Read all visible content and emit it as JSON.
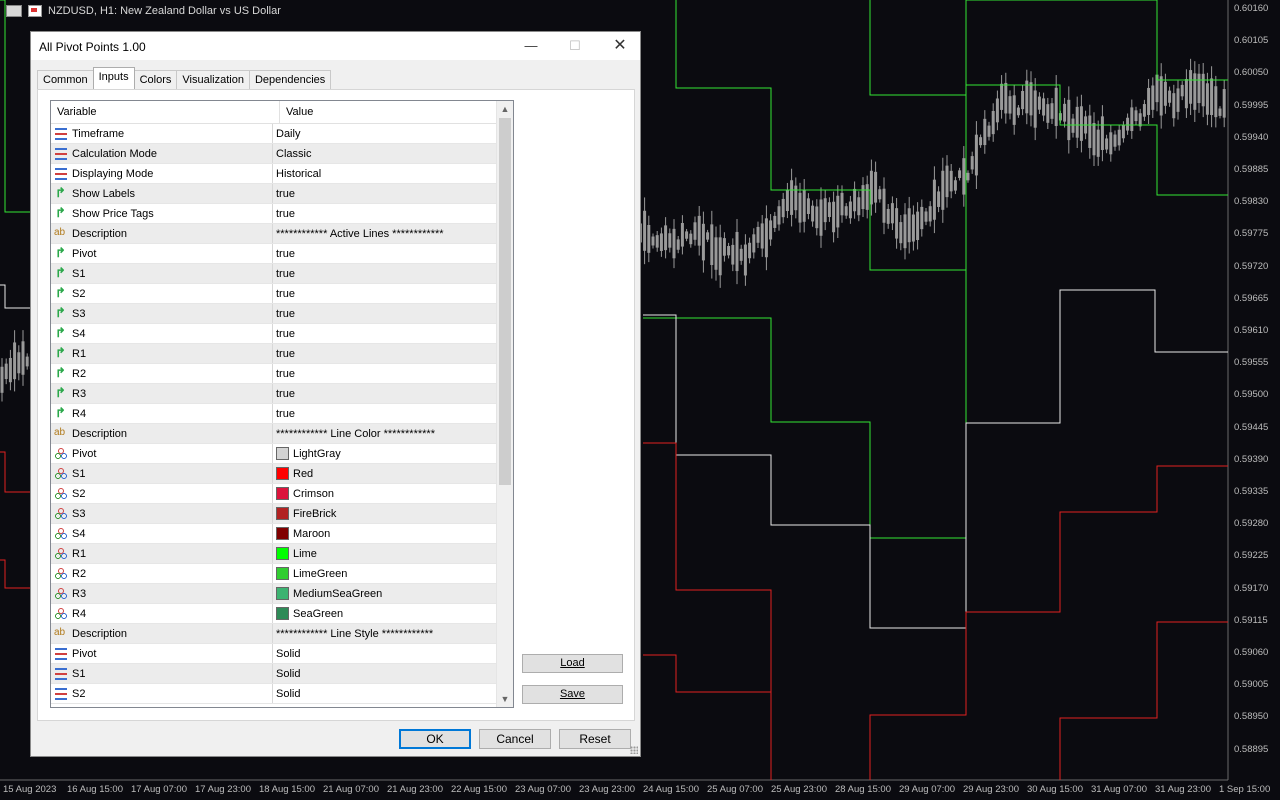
{
  "chart": {
    "symbol_title": "NZDUSD, H1:  New Zealand Dollar vs US Dollar",
    "price_labels": [
      "0.60160",
      "0.60105",
      "0.60050",
      "0.59995",
      "0.59940",
      "0.59885",
      "0.59830",
      "0.59775",
      "0.59720",
      "0.59665",
      "0.59610",
      "0.59555",
      "0.59500",
      "0.59445",
      "0.59390",
      "0.59335",
      "0.59280",
      "0.59225",
      "0.59170",
      "0.59115",
      "0.59060",
      "0.59005",
      "0.58950",
      "0.58895"
    ],
    "time_labels": [
      "15 Aug 2023",
      "16 Aug 15:00",
      "17 Aug 07:00",
      "17 Aug 23:00",
      "18 Aug 15:00",
      "21 Aug 07:00",
      "21 Aug 23:00",
      "22 Aug 15:00",
      "23 Aug 07:00",
      "23 Aug 23:00",
      "24 Aug 15:00",
      "25 Aug 07:00",
      "25 Aug 23:00",
      "28 Aug 15:00",
      "29 Aug 07:00",
      "29 Aug 23:00",
      "30 Aug 15:00",
      "31 Aug 07:00",
      "31 Aug 23:00",
      "1 Sep 15:00"
    ],
    "colors": {
      "background": "#0b0b10",
      "resistance": "#33e633",
      "support": "#e02020",
      "pivot": "#e8e8e8",
      "candle": "#9a9a9a"
    }
  },
  "dialog": {
    "title": "All Pivot Points 1.00",
    "minimize_icon": "minimize-icon",
    "maximize_icon": "maximize-icon",
    "close_icon": "close-icon",
    "tabs": [
      "Common",
      "Inputs",
      "Colors",
      "Visualization",
      "Dependencies"
    ],
    "active_tab": "Inputs",
    "grid": {
      "col_variable": "Variable",
      "col_value": "Value",
      "rows": [
        {
          "icon": "enum",
          "name": "Timeframe",
          "value": "Daily"
        },
        {
          "icon": "enum",
          "name": "Calculation Mode",
          "value": "Classic"
        },
        {
          "icon": "enum",
          "name": "Displaying Mode",
          "value": "Historical"
        },
        {
          "icon": "bool",
          "name": "Show Labels",
          "value": "true"
        },
        {
          "icon": "bool",
          "name": "Show Price Tags",
          "value": "true"
        },
        {
          "icon": "text",
          "name": "Description",
          "value": "************ Active Lines ************"
        },
        {
          "icon": "bool",
          "name": "Pivot",
          "value": "true"
        },
        {
          "icon": "bool",
          "name": "S1",
          "value": "true"
        },
        {
          "icon": "bool",
          "name": "S2",
          "value": "true"
        },
        {
          "icon": "bool",
          "name": "S3",
          "value": "true"
        },
        {
          "icon": "bool",
          "name": "S4",
          "value": "true"
        },
        {
          "icon": "bool",
          "name": "R1",
          "value": "true"
        },
        {
          "icon": "bool",
          "name": "R2",
          "value": "true"
        },
        {
          "icon": "bool",
          "name": "R3",
          "value": "true"
        },
        {
          "icon": "bool",
          "name": "R4",
          "value": "true"
        },
        {
          "icon": "text",
          "name": "Description",
          "value": "************ Line Color ************"
        },
        {
          "icon": "color",
          "name": "Pivot",
          "value": "LightGray",
          "swatch": "#d3d3d3"
        },
        {
          "icon": "color",
          "name": "S1",
          "value": "Red",
          "swatch": "#ff0000"
        },
        {
          "icon": "color",
          "name": "S2",
          "value": "Crimson",
          "swatch": "#dc143c"
        },
        {
          "icon": "color",
          "name": "S3",
          "value": "FireBrick",
          "swatch": "#b22222"
        },
        {
          "icon": "color",
          "name": "S4",
          "value": "Maroon",
          "swatch": "#800000"
        },
        {
          "icon": "color",
          "name": "R1",
          "value": "Lime",
          "swatch": "#00ff00"
        },
        {
          "icon": "color",
          "name": "R2",
          "value": "LimeGreen",
          "swatch": "#32cd32"
        },
        {
          "icon": "color",
          "name": "R3",
          "value": "MediumSeaGreen",
          "swatch": "#3cb371"
        },
        {
          "icon": "color",
          "name": "R4",
          "value": "SeaGreen",
          "swatch": "#2e8b57"
        },
        {
          "icon": "text",
          "name": "Description",
          "value": "************ Line Style ************"
        },
        {
          "icon": "enum",
          "name": "Pivot",
          "value": "Solid"
        },
        {
          "icon": "enum",
          "name": "S1",
          "value": "Solid"
        },
        {
          "icon": "enum",
          "name": "S2",
          "value": "Solid"
        }
      ]
    },
    "load_label": "Load",
    "save_label": "Save",
    "ok_label": "OK",
    "cancel_label": "Cancel",
    "reset_label": "Reset"
  }
}
